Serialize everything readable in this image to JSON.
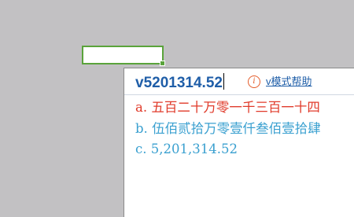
{
  "ime": {
    "input_text": "v5201314.52",
    "help_link": "v模式帮助",
    "candidates": [
      {
        "index": "a.",
        "text": "五百二十万零一千三百一十四"
      },
      {
        "index": "b.",
        "text": "伍佰贰拾万零壹仟叁佰壹拾肆"
      },
      {
        "index": "c.",
        "text": "5,201,314.52"
      }
    ],
    "info_icon": "info-circle-icon"
  },
  "colors": {
    "selected_candidate": "#e03a2a",
    "candidate": "#3aa0d0",
    "input": "#1f5ea8",
    "cell_border": "#5aa33b"
  }
}
